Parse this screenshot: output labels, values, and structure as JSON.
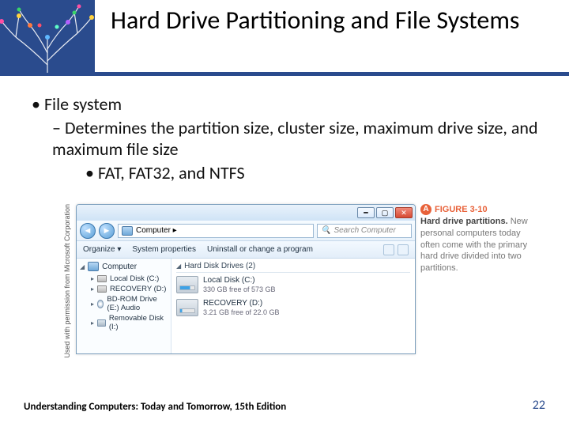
{
  "header": {
    "title": "Hard Drive Partitioning and File Systems"
  },
  "bullets": {
    "l1": "File system",
    "l2": "Determines the partition size, cluster size, maximum drive size, and maximum file size",
    "l3": "FAT, FAT32, and NTFS"
  },
  "permission": "Used with permission from Microsoft Corporation",
  "window": {
    "address": "Computer ▸",
    "search_placeholder": "Search Computer",
    "toolbar": {
      "organize": "Organize ▾",
      "props": "System properties",
      "uninstall": "Uninstall or change a program"
    },
    "sidebar": {
      "root": "Computer",
      "items": [
        "Local Disk (C:)",
        "RECOVERY (D:)",
        "BD-ROM Drive (E:) Audio",
        "Removable Disk (I:)"
      ]
    },
    "content": {
      "group": "Hard Disk Drives (2)",
      "drives": [
        {
          "name": "Local Disk (C:)",
          "sub": "330 GB free of 573 GB"
        },
        {
          "name": "RECOVERY (D:)",
          "sub": "3.21 GB free of 22.0 GB"
        }
      ]
    }
  },
  "caption": {
    "badge": "A",
    "fig": "FIGURE 3-10",
    "title": "Hard drive partitions.",
    "text": "New personal computers today often come with the primary hard drive divided into two partitions."
  },
  "footer": {
    "text": "Understanding Computers: Today and Tomorrow, 15th Edition",
    "page": "22"
  }
}
